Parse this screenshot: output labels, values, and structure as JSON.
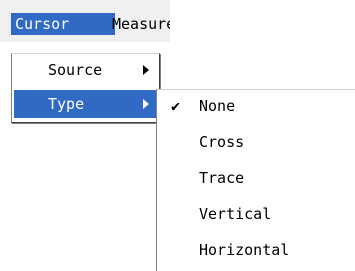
{
  "menubar": {
    "cursor_label": "Cursor",
    "measure_label": "Measure"
  },
  "cursor_menu": {
    "items": [
      {
        "label": "Source",
        "has_submenu": true
      },
      {
        "label": "Type",
        "has_submenu": true,
        "active": true
      }
    ]
  },
  "type_menu": {
    "items": [
      {
        "label": "None",
        "checked": true
      },
      {
        "label": "Cross"
      },
      {
        "label": "Trace"
      },
      {
        "label": "Vertical"
      },
      {
        "label": "Horizontal"
      }
    ]
  },
  "colors": {
    "highlight": "#316ac5",
    "menubar_bg": "#f0f0f0"
  },
  "icons": {
    "check": "check-icon",
    "submenu_arrow": "chevron-right-icon"
  }
}
